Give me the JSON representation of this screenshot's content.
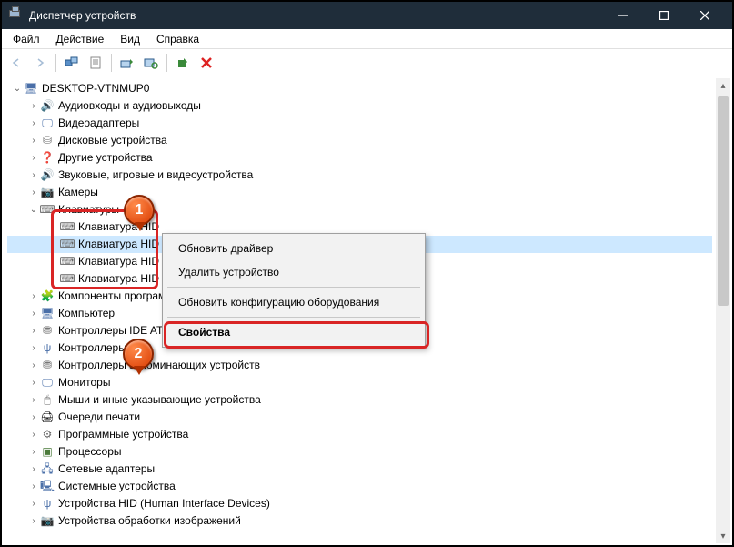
{
  "window": {
    "title": "Диспетчер устройств"
  },
  "menu": {
    "file": "Файл",
    "action": "Действие",
    "view": "Вид",
    "help": "Справка"
  },
  "tree": {
    "root": "DESKTOP-VTNMUP0",
    "audio": "Аудиовходы и аудиовыходы",
    "video": "Видеоадаптеры",
    "disks": "Дисковые устройства",
    "other": "Другие устройства",
    "sound": "Звуковые, игровые и видеоустройства",
    "cameras": "Камеры",
    "keyboards": "Клавиатуры",
    "kb1": "Клавиатура HID",
    "kb2": "Клавиатура HID",
    "kb3": "Клавиатура HID",
    "kb4": "Клавиатура HID",
    "software": "Компоненты программного обеспечения",
    "computer": "Компьютер",
    "ide": "Контроллеры IDE ATA/ATAPI",
    "usb": "Контроллеры USB",
    "storage": "Контроллеры запоминающих устройств",
    "monitors": "Мониторы",
    "mice": "Мыши и иные указывающие устройства",
    "printq": "Очереди печати",
    "progdev": "Программные устройства",
    "cpus": "Процессоры",
    "network": "Сетевые адаптеры",
    "sysdev": "Системные устройства",
    "hid": "Устройства HID (Human Interface Devices)",
    "imaging": "Устройства обработки изображений"
  },
  "context": {
    "update": "Обновить драйвер",
    "delete": "Удалить устройство",
    "scan": "Обновить конфигурацию оборудования",
    "props": "Свойства"
  },
  "callouts": {
    "one": "1",
    "two": "2"
  }
}
